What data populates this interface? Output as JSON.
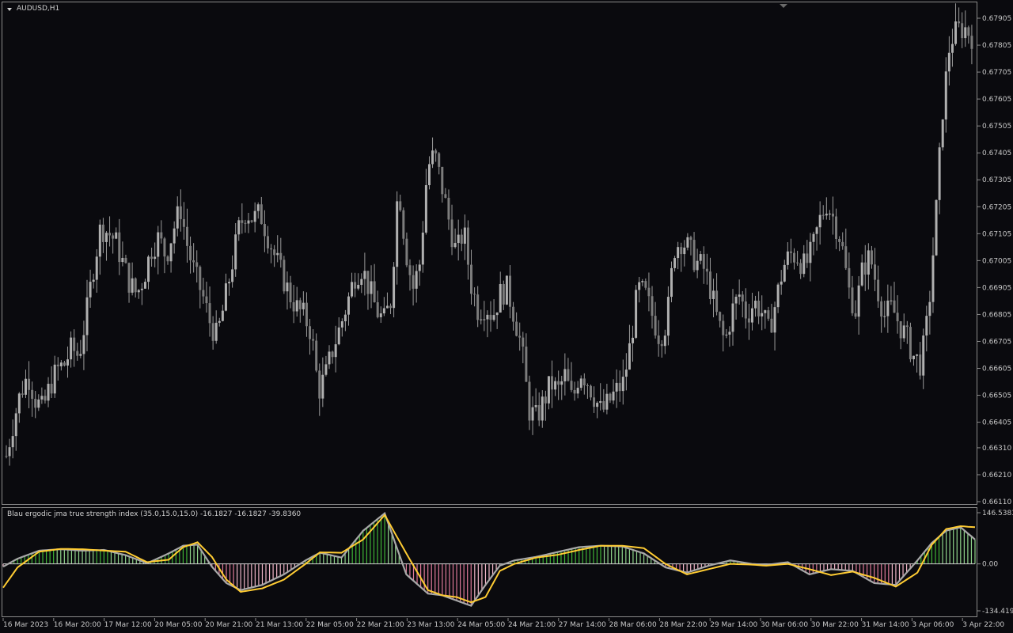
{
  "chart_data": [
    {
      "type": "candlestick",
      "title": "AUDUSD,H1",
      "ylim": [
        0.6611,
        0.67955
      ],
      "y_ticks": [
        "0.67905",
        "0.67805",
        "0.67705",
        "0.67605",
        "0.67505",
        "0.67405",
        "0.67305",
        "0.67205",
        "0.67105",
        "0.67005",
        "0.66905",
        "0.66805",
        "0.66705",
        "0.66605",
        "0.66505",
        "0.66405",
        "0.66310",
        "0.66210",
        "0.66110"
      ],
      "x_ticks": [
        "16 Mar 2023",
        "16 Mar 20:00",
        "17 Mar 12:00",
        "20 Mar 05:00",
        "20 Mar 21:00",
        "21 Mar 13:00",
        "22 Mar 05:00",
        "22 Mar 21:00",
        "23 Mar 13:00",
        "24 Mar 05:00",
        "24 Mar 21:00",
        "27 Mar 14:00",
        "28 Mar 06:00",
        "28 Mar 22:00",
        "29 Mar 14:00",
        "30 Mar 06:00",
        "30 Mar 22:00",
        "31 Mar 14:00",
        "3 Apr 06:00",
        "3 Apr 22:00"
      ],
      "close_path": [
        0.6628,
        0.6641,
        0.6652,
        0.6658,
        0.6649,
        0.6645,
        0.6654,
        0.666,
        0.6662,
        0.6668,
        0.6665,
        0.668,
        0.6698,
        0.6713,
        0.6711,
        0.6708,
        0.67,
        0.6692,
        0.6688,
        0.6695,
        0.6705,
        0.6709,
        0.6702,
        0.6712,
        0.672,
        0.6705,
        0.6695,
        0.6688,
        0.6678,
        0.6672,
        0.6684,
        0.6698,
        0.6712,
        0.6719,
        0.6716,
        0.6718,
        0.671,
        0.6702,
        0.6695,
        0.6688,
        0.6683,
        0.668,
        0.6674,
        0.6652,
        0.6658,
        0.6668,
        0.6676,
        0.6685,
        0.6695,
        0.6698,
        0.669,
        0.6682,
        0.6678,
        0.6686,
        0.673,
        0.6705,
        0.669,
        0.67,
        0.6735,
        0.674,
        0.6728,
        0.6715,
        0.6703,
        0.6712,
        0.6692,
        0.6682,
        0.6684,
        0.668,
        0.6688,
        0.669,
        0.668,
        0.6668,
        0.6645,
        0.6642,
        0.6648,
        0.6655,
        0.6652,
        0.6658,
        0.6648,
        0.666,
        0.6656,
        0.665,
        0.6644,
        0.6648,
        0.6652,
        0.6655,
        0.667,
        0.669,
        0.6688,
        0.668,
        0.6672,
        0.6678,
        0.6705,
        0.6708,
        0.6705,
        0.67,
        0.6698,
        0.669,
        0.6678,
        0.667,
        0.6682,
        0.6688,
        0.668,
        0.6685,
        0.6682,
        0.6674,
        0.6685,
        0.6698,
        0.6703,
        0.6702,
        0.6698,
        0.6704,
        0.6715,
        0.6722,
        0.6716,
        0.6708,
        0.669,
        0.6682,
        0.6698,
        0.6702,
        0.669,
        0.668,
        0.6683,
        0.6677,
        0.6672,
        0.6665,
        0.6662,
        0.668,
        0.6715,
        0.6757,
        0.6782,
        0.6786,
        0.6787,
        0.6784
      ]
    },
    {
      "type": "line",
      "title": "Blau ergodic jma true strength index (35.0,15.0,15.0) -16.1827 -16.1827 -39.8360",
      "ylim": [
        -134.4193,
        146.5383
      ],
      "y_ticks": [
        "146.5383",
        "0.00",
        "-134.4193"
      ],
      "series": [
        {
          "name": "-16.1827",
          "color": "#a8a8a8",
          "x": [
            0,
            2,
            5,
            8,
            11,
            14,
            17,
            20,
            23,
            25,
            27,
            29,
            31,
            33,
            36,
            39,
            42,
            44,
            47,
            50,
            53,
            56,
            59,
            61,
            63,
            65,
            67,
            69,
            71,
            74,
            77,
            80,
            83,
            86,
            89,
            92,
            95,
            98,
            101,
            104,
            106,
            109,
            112,
            115,
            118,
            121,
            124,
            127,
            129,
            131,
            133,
            135
          ],
          "values": [
            -8,
            15,
            38,
            42,
            38,
            40,
            25,
            2,
            30,
            52,
            55,
            -8,
            -55,
            -75,
            -60,
            -30,
            10,
            32,
            18,
            95,
            145,
            -30,
            -85,
            -90,
            -105,
            -120,
            -60,
            -5,
            10,
            20,
            34,
            48,
            52,
            50,
            30,
            -10,
            -25,
            -5,
            10,
            0,
            -3,
            5,
            -30,
            -15,
            -20,
            -55,
            -60,
            10,
            60,
            95,
            105,
            70
          ]
        },
        {
          "name": "-39.8360",
          "color": "#ffcc33",
          "x": [
            0,
            2,
            5,
            8,
            11,
            14,
            17,
            20,
            23,
            25,
            27,
            29,
            31,
            33,
            36,
            39,
            42,
            44,
            47,
            50,
            53,
            56,
            59,
            61,
            63,
            65,
            67,
            69,
            71,
            74,
            77,
            80,
            83,
            86,
            89,
            92,
            95,
            98,
            101,
            104,
            106,
            109,
            112,
            115,
            118,
            121,
            124,
            127,
            129,
            131,
            133,
            135
          ],
          "values": [
            -68,
            -10,
            35,
            43,
            42,
            38,
            35,
            5,
            12,
            48,
            62,
            20,
            -45,
            -80,
            -70,
            -45,
            0,
            33,
            32,
            70,
            140,
            30,
            -75,
            -90,
            -95,
            -110,
            -95,
            -20,
            0,
            18,
            26,
            40,
            52,
            52,
            45,
            0,
            -30,
            -15,
            0,
            -2,
            -5,
            0,
            -15,
            -32,
            -22,
            -40,
            -65,
            -25,
            55,
            100,
            108,
            105
          ]
        }
      ]
    }
  ]
}
